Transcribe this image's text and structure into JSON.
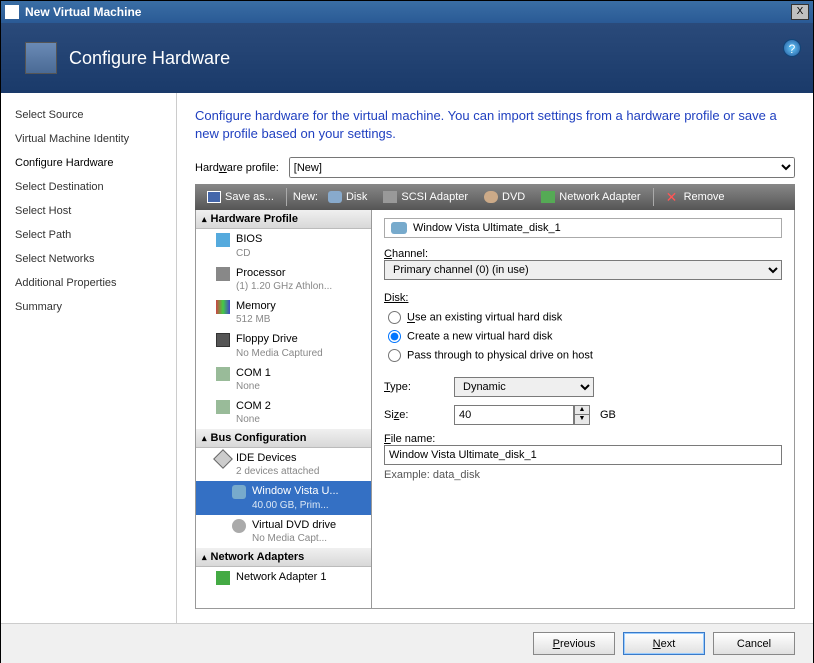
{
  "window": {
    "title": "New Virtual Machine",
    "close": "X",
    "help_tip": "?"
  },
  "header": {
    "title": "Configure Hardware"
  },
  "sidebar": {
    "items": [
      "Select Source",
      "Virtual Machine Identity",
      "Configure Hardware",
      "Select Destination",
      "Select Host",
      "Select Path",
      "Select Networks",
      "Additional Properties",
      "Summary"
    ],
    "active_index": 2
  },
  "description": "Configure hardware for the virtual machine. You can import settings from a hardware profile or save a new profile based on your settings.",
  "hw_profile": {
    "label": "Hardware profile:",
    "value": "[New]"
  },
  "toolbar": {
    "save_as": "Save as...",
    "new": "New:",
    "disk": "Disk",
    "scsi": "SCSI Adapter",
    "dvd": "DVD",
    "net": "Network Adapter",
    "remove": "Remove"
  },
  "tree": {
    "hw_profile_header": "Hardware Profile",
    "bios": {
      "label": "BIOS",
      "sub": "CD"
    },
    "cpu": {
      "label": "Processor",
      "sub": "(1) 1.20 GHz Athlon..."
    },
    "mem": {
      "label": "Memory",
      "sub": "512 MB"
    },
    "floppy": {
      "label": "Floppy Drive",
      "sub": "No Media Captured"
    },
    "com1": {
      "label": "COM 1",
      "sub": "None"
    },
    "com2": {
      "label": "COM 2",
      "sub": "None"
    },
    "bus_header": "Bus Configuration",
    "ide": {
      "label": "IDE Devices",
      "sub": "2 devices attached"
    },
    "vhd": {
      "label": "Window Vista U...",
      "sub": "40.00 GB, Prim..."
    },
    "vdvd": {
      "label": "Virtual DVD drive",
      "sub": "No Media Capt..."
    },
    "net_header": "Network Adapters",
    "net1": {
      "label": "Network Adapter 1",
      "sub": ""
    }
  },
  "detail": {
    "disk_name": "Window Vista Ultimate_disk_1",
    "channel_label": "Channel:",
    "channel_value": "Primary channel (0) (in use)",
    "disk_label": "Disk:",
    "radio_existing": "Use an existing virtual hard disk",
    "radio_new": "Create a new virtual hard disk",
    "radio_pass": "Pass through to physical drive on host",
    "type_label": "Type:",
    "type_value": "Dynamic",
    "size_label": "Size:",
    "size_value": "40",
    "size_unit": "GB",
    "filename_label": "File name:",
    "filename_value": "Window Vista Ultimate_disk_1",
    "example": "Example: data_disk"
  },
  "footer": {
    "previous": "Previous",
    "next": "Next",
    "cancel": "Cancel"
  }
}
